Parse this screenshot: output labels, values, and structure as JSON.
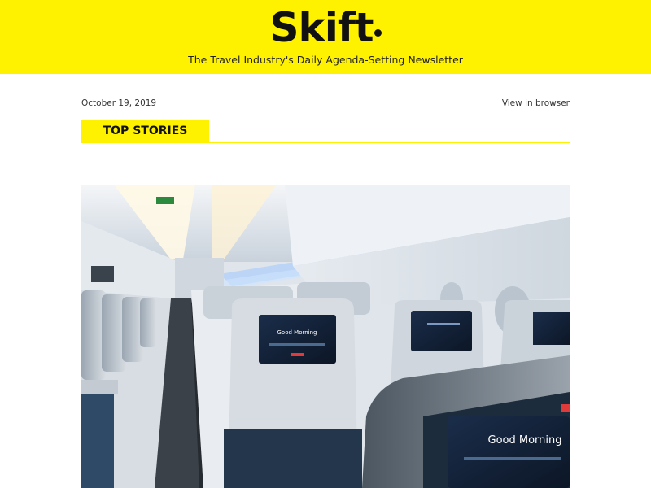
{
  "header": {
    "logo_text": "Skift",
    "tagline": "The Travel Industry's Daily Agenda-Setting Newsletter",
    "brand_color": "#fff200"
  },
  "meta": {
    "date": "October 19, 2019",
    "view_in_browser": "View in browser"
  },
  "section": {
    "title": "TOP STORIES"
  },
  "hero": {
    "screen_text": "Good Morning",
    "icon": "airplane-cabin-photo"
  }
}
